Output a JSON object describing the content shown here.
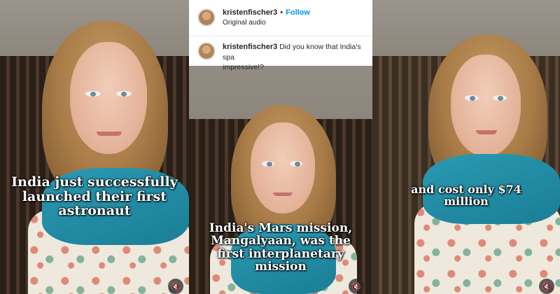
{
  "panels": [
    {
      "caption": "India just successfully launched their first astronaut"
    },
    {
      "caption": "India's Mars mission, Mangalyaan, was the first interplanetary mission"
    },
    {
      "caption": "and cost only $74 million"
    }
  ],
  "post_header": {
    "username": "kristenfischer3",
    "separator": "•",
    "follow_label": "Follow",
    "audio_label": "Original audio"
  },
  "comment": {
    "username": "kristenfischer3",
    "text_line1": "Did you know that India's spa",
    "text_line2": "impressive!?"
  },
  "icons": {
    "mute": "speaker-muted-icon",
    "glyph": "🔇"
  },
  "colors": {
    "caption": "#ffffff",
    "follow": "#0095f6",
    "scarf": "#1f8aa3"
  }
}
